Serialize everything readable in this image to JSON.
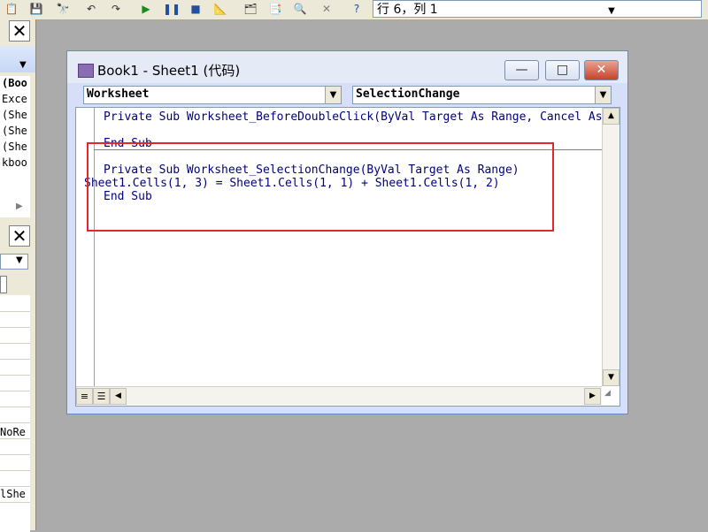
{
  "status": {
    "position": "行 6，列 1"
  },
  "toolbar": {
    "icons": [
      "paste-icon",
      "save-icon",
      "find-icon",
      "undo-icon",
      "redo-icon",
      "run-icon",
      "break-icon",
      "reset-icon",
      "design-mode-icon",
      "project-explorer-icon",
      "properties-icon",
      "object-browser-icon",
      "toolbox-icon",
      "help-icon"
    ]
  },
  "left_panel": {
    "project_lines": [
      "(Boo",
      "Exce",
      "(She",
      "(She",
      "(She",
      "kboo"
    ],
    "property_values": [
      "NoRe",
      "lShe"
    ]
  },
  "code_window": {
    "title": "Book1 - Sheet1 (代码)",
    "object_combo": "Worksheet",
    "procedure_combo": "SelectionChange",
    "min_label": "—",
    "max_label": "□",
    "close_label": "✕",
    "code": {
      "line1": "Private Sub Worksheet_BeforeDoubleClick(ByVal Target As Range, Cancel As Boolean)",
      "line2": "End Sub",
      "line3": "Private Sub Worksheet_SelectionChange(ByVal Target As Range)",
      "line4": "Sheet1.Cells(1, 3) = Sheet1.Cells(1, 1) + Sheet1.Cells(1, 2)",
      "line5": "End Sub"
    }
  },
  "colors": {
    "highlight": "#e0282e",
    "code_text": "#00007f",
    "background": "#ababab"
  }
}
